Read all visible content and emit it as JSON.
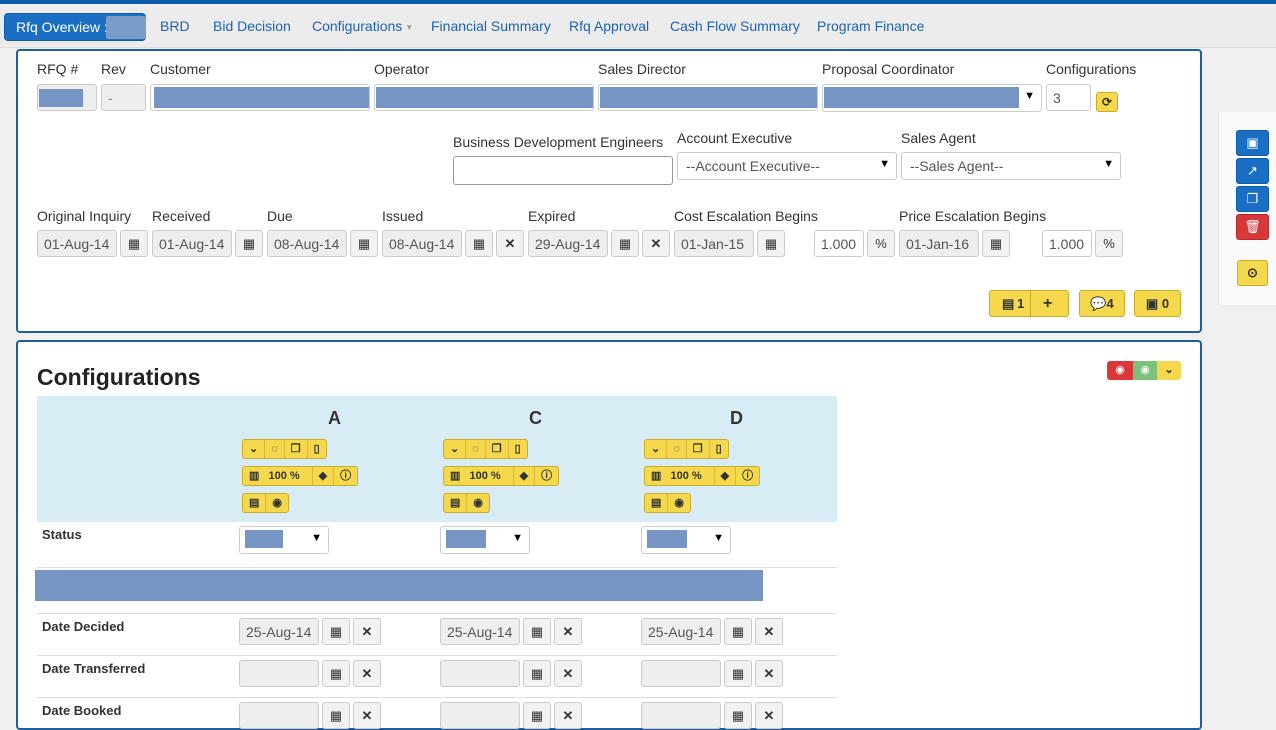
{
  "nav": {
    "active_tab": "Rfq Overview :",
    "tabs": [
      {
        "label": "BRD"
      },
      {
        "label": "Bid Decision"
      },
      {
        "label": "Configurations"
      },
      {
        "label": "Financial Summary"
      },
      {
        "label": "Rfq Approval"
      },
      {
        "label": "Cash Flow Summary"
      },
      {
        "label": "Program Finance"
      }
    ]
  },
  "rfq": {
    "labels": {
      "rfq_no": "RFQ #",
      "rev": "Rev",
      "customer": "Customer",
      "operator": "Operator",
      "sales_director": "Sales Director",
      "proposal_coordinator": "Proposal Coordinator",
      "configurations": "Configurations",
      "bde": "Business Development Engineers",
      "account_exec": "Account Executive",
      "sales_agent": "Sales Agent",
      "original_inquiry": "Original Inquiry",
      "received": "Received",
      "due": "Due",
      "issued": "Issued",
      "expired": "Expired",
      "cost_escalation": "Cost Escalation Begins",
      "price_escalation": "Price Escalation Begins"
    },
    "values": {
      "rev": "-",
      "configurations": "3",
      "account_exec_placeholder": "--Account Executive--",
      "sales_agent_placeholder": "--Sales Agent--",
      "original_inquiry": "01-Aug-14",
      "received": "01-Aug-14",
      "due": "08-Aug-14",
      "issued": "08-Aug-14",
      "expired": "29-Aug-14",
      "cost_escalation_date": "01-Jan-15",
      "cost_escalation_rate": "1.000",
      "price_escalation_date": "01-Jan-16",
      "price_escalation_rate": "1.000",
      "percent": "%"
    },
    "actions": {
      "docs_count": "1",
      "comments_count": "4",
      "money_count": "0"
    }
  },
  "configurations": {
    "title": "Configurations",
    "columns": [
      {
        "letter": "A",
        "pct": "100 %"
      },
      {
        "letter": "C",
        "pct": "100 %"
      },
      {
        "letter": "D",
        "pct": "100 %"
      }
    ],
    "rows": {
      "status": "Status",
      "date_decided": "Date Decided",
      "date_transferred": "Date Transferred",
      "date_booked": "Date Booked"
    },
    "date_decided_values": [
      "25-Aug-14",
      "25-Aug-14",
      "25-Aug-14"
    ]
  }
}
